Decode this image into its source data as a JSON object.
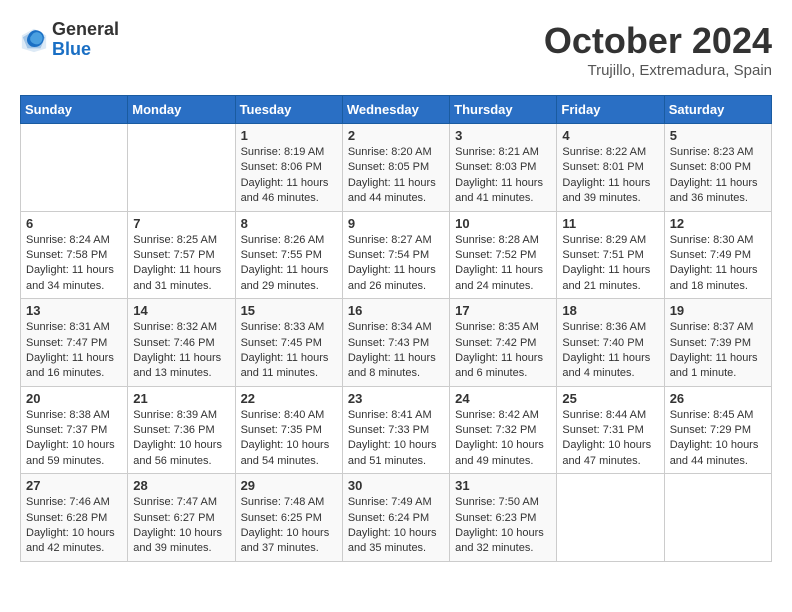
{
  "logo": {
    "general": "General",
    "blue": "Blue"
  },
  "title": "October 2024",
  "location": "Trujillo, Extremadura, Spain",
  "days_of_week": [
    "Sunday",
    "Monday",
    "Tuesday",
    "Wednesday",
    "Thursday",
    "Friday",
    "Saturday"
  ],
  "weeks": [
    [
      {
        "day": "",
        "sunrise": "",
        "sunset": "",
        "daylight": ""
      },
      {
        "day": "",
        "sunrise": "",
        "sunset": "",
        "daylight": ""
      },
      {
        "day": "1",
        "sunrise": "Sunrise: 8:19 AM",
        "sunset": "Sunset: 8:06 PM",
        "daylight": "Daylight: 11 hours and 46 minutes."
      },
      {
        "day": "2",
        "sunrise": "Sunrise: 8:20 AM",
        "sunset": "Sunset: 8:05 PM",
        "daylight": "Daylight: 11 hours and 44 minutes."
      },
      {
        "day": "3",
        "sunrise": "Sunrise: 8:21 AM",
        "sunset": "Sunset: 8:03 PM",
        "daylight": "Daylight: 11 hours and 41 minutes."
      },
      {
        "day": "4",
        "sunrise": "Sunrise: 8:22 AM",
        "sunset": "Sunset: 8:01 PM",
        "daylight": "Daylight: 11 hours and 39 minutes."
      },
      {
        "day": "5",
        "sunrise": "Sunrise: 8:23 AM",
        "sunset": "Sunset: 8:00 PM",
        "daylight": "Daylight: 11 hours and 36 minutes."
      }
    ],
    [
      {
        "day": "6",
        "sunrise": "Sunrise: 8:24 AM",
        "sunset": "Sunset: 7:58 PM",
        "daylight": "Daylight: 11 hours and 34 minutes."
      },
      {
        "day": "7",
        "sunrise": "Sunrise: 8:25 AM",
        "sunset": "Sunset: 7:57 PM",
        "daylight": "Daylight: 11 hours and 31 minutes."
      },
      {
        "day": "8",
        "sunrise": "Sunrise: 8:26 AM",
        "sunset": "Sunset: 7:55 PM",
        "daylight": "Daylight: 11 hours and 29 minutes."
      },
      {
        "day": "9",
        "sunrise": "Sunrise: 8:27 AM",
        "sunset": "Sunset: 7:54 PM",
        "daylight": "Daylight: 11 hours and 26 minutes."
      },
      {
        "day": "10",
        "sunrise": "Sunrise: 8:28 AM",
        "sunset": "Sunset: 7:52 PM",
        "daylight": "Daylight: 11 hours and 24 minutes."
      },
      {
        "day": "11",
        "sunrise": "Sunrise: 8:29 AM",
        "sunset": "Sunset: 7:51 PM",
        "daylight": "Daylight: 11 hours and 21 minutes."
      },
      {
        "day": "12",
        "sunrise": "Sunrise: 8:30 AM",
        "sunset": "Sunset: 7:49 PM",
        "daylight": "Daylight: 11 hours and 18 minutes."
      }
    ],
    [
      {
        "day": "13",
        "sunrise": "Sunrise: 8:31 AM",
        "sunset": "Sunset: 7:47 PM",
        "daylight": "Daylight: 11 hours and 16 minutes."
      },
      {
        "day": "14",
        "sunrise": "Sunrise: 8:32 AM",
        "sunset": "Sunset: 7:46 PM",
        "daylight": "Daylight: 11 hours and 13 minutes."
      },
      {
        "day": "15",
        "sunrise": "Sunrise: 8:33 AM",
        "sunset": "Sunset: 7:45 PM",
        "daylight": "Daylight: 11 hours and 11 minutes."
      },
      {
        "day": "16",
        "sunrise": "Sunrise: 8:34 AM",
        "sunset": "Sunset: 7:43 PM",
        "daylight": "Daylight: 11 hours and 8 minutes."
      },
      {
        "day": "17",
        "sunrise": "Sunrise: 8:35 AM",
        "sunset": "Sunset: 7:42 PM",
        "daylight": "Daylight: 11 hours and 6 minutes."
      },
      {
        "day": "18",
        "sunrise": "Sunrise: 8:36 AM",
        "sunset": "Sunset: 7:40 PM",
        "daylight": "Daylight: 11 hours and 4 minutes."
      },
      {
        "day": "19",
        "sunrise": "Sunrise: 8:37 AM",
        "sunset": "Sunset: 7:39 PM",
        "daylight": "Daylight: 11 hours and 1 minute."
      }
    ],
    [
      {
        "day": "20",
        "sunrise": "Sunrise: 8:38 AM",
        "sunset": "Sunset: 7:37 PM",
        "daylight": "Daylight: 10 hours and 59 minutes."
      },
      {
        "day": "21",
        "sunrise": "Sunrise: 8:39 AM",
        "sunset": "Sunset: 7:36 PM",
        "daylight": "Daylight: 10 hours and 56 minutes."
      },
      {
        "day": "22",
        "sunrise": "Sunrise: 8:40 AM",
        "sunset": "Sunset: 7:35 PM",
        "daylight": "Daylight: 10 hours and 54 minutes."
      },
      {
        "day": "23",
        "sunrise": "Sunrise: 8:41 AM",
        "sunset": "Sunset: 7:33 PM",
        "daylight": "Daylight: 10 hours and 51 minutes."
      },
      {
        "day": "24",
        "sunrise": "Sunrise: 8:42 AM",
        "sunset": "Sunset: 7:32 PM",
        "daylight": "Daylight: 10 hours and 49 minutes."
      },
      {
        "day": "25",
        "sunrise": "Sunrise: 8:44 AM",
        "sunset": "Sunset: 7:31 PM",
        "daylight": "Daylight: 10 hours and 47 minutes."
      },
      {
        "day": "26",
        "sunrise": "Sunrise: 8:45 AM",
        "sunset": "Sunset: 7:29 PM",
        "daylight": "Daylight: 10 hours and 44 minutes."
      }
    ],
    [
      {
        "day": "27",
        "sunrise": "Sunrise: 7:46 AM",
        "sunset": "Sunset: 6:28 PM",
        "daylight": "Daylight: 10 hours and 42 minutes."
      },
      {
        "day": "28",
        "sunrise": "Sunrise: 7:47 AM",
        "sunset": "Sunset: 6:27 PM",
        "daylight": "Daylight: 10 hours and 39 minutes."
      },
      {
        "day": "29",
        "sunrise": "Sunrise: 7:48 AM",
        "sunset": "Sunset: 6:25 PM",
        "daylight": "Daylight: 10 hours and 37 minutes."
      },
      {
        "day": "30",
        "sunrise": "Sunrise: 7:49 AM",
        "sunset": "Sunset: 6:24 PM",
        "daylight": "Daylight: 10 hours and 35 minutes."
      },
      {
        "day": "31",
        "sunrise": "Sunrise: 7:50 AM",
        "sunset": "Sunset: 6:23 PM",
        "daylight": "Daylight: 10 hours and 32 minutes."
      },
      {
        "day": "",
        "sunrise": "",
        "sunset": "",
        "daylight": ""
      },
      {
        "day": "",
        "sunrise": "",
        "sunset": "",
        "daylight": ""
      }
    ]
  ]
}
